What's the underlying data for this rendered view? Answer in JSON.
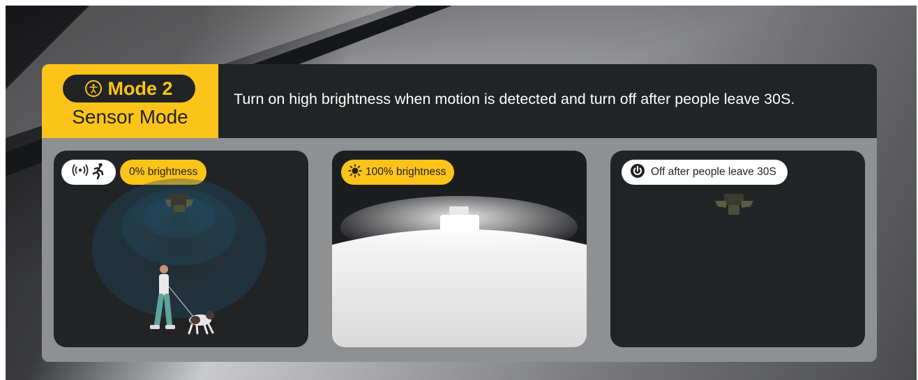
{
  "header": {
    "mode_title": "Mode 2",
    "mode_subtitle": "Sensor Mode",
    "description": "Turn on high brightness when motion is detected and turn off after people leave 30S."
  },
  "cards": [
    {
      "badge": "0% brightness",
      "icons": [
        "motion-wave-icon",
        "running-person-icon"
      ]
    },
    {
      "badge": "100% brightness",
      "icons": [
        "sun-icon"
      ]
    },
    {
      "badge": "Off after people leave 30S",
      "icons": [
        "power-icon"
      ]
    }
  ],
  "colors": {
    "accent": "#fcc419",
    "dark": "#222325"
  }
}
